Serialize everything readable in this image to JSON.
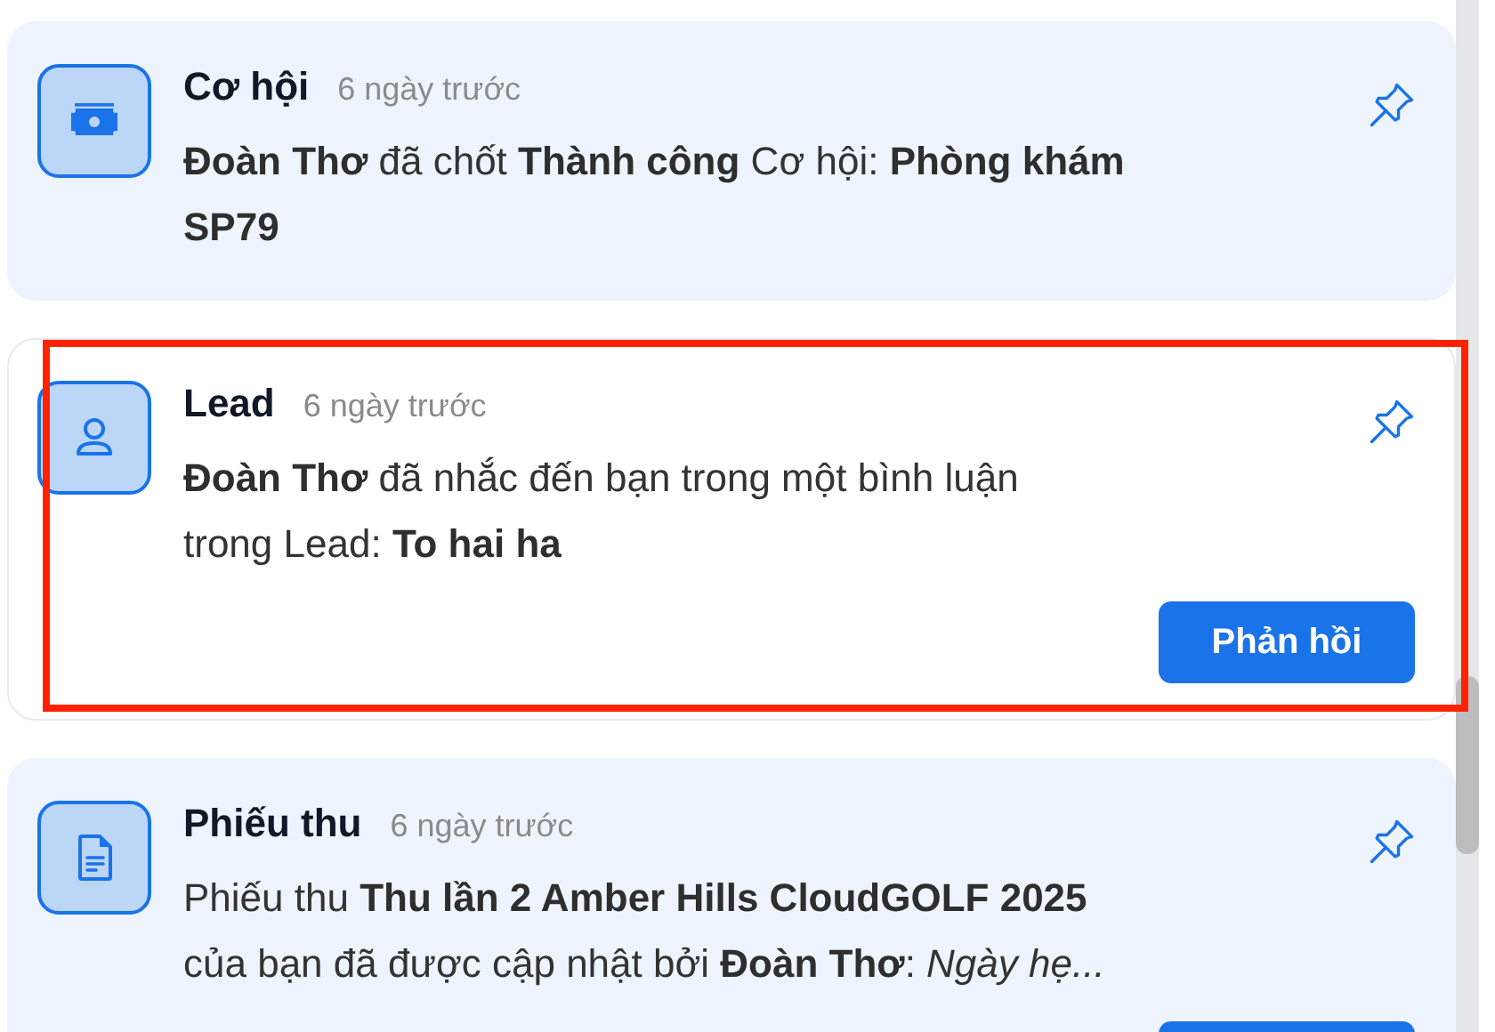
{
  "notifications": [
    {
      "kind": "money",
      "title": "Cơ hội",
      "time": "6 ngày trước",
      "text": "**Đoàn Thơ** đã chốt **Thành công** Cơ hội: **Phòng khám**\n**SP79**",
      "unread": true,
      "highlighted": false,
      "has_reply_button": false
    },
    {
      "kind": "person",
      "title": "Lead",
      "time": "6 ngày trước",
      "text": "**Đoàn Thơ** đã nhắc đến bạn trong một bình luận\ntrong Lead: **To hai ha**",
      "unread": false,
      "highlighted": true,
      "has_reply_button": true,
      "button_label": "Phản hồi"
    },
    {
      "kind": "document",
      "title": "Phiếu thu",
      "time": "6 ngày trước",
      "text": "Phiếu thu **Thu lần 2 Amber Hills CloudGOLF 2025**\ncủa bạn đã được cập nhật bởi **Đoàn Thơ**: *Ngày hẹ...*",
      "unread": true,
      "highlighted": false,
      "has_reply_button": true
    }
  ]
}
